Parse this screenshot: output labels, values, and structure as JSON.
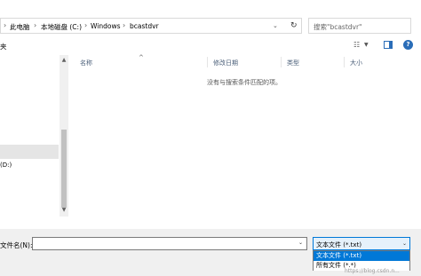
{
  "address_bar": {
    "breadcrumbs": [
      "此电脑",
      "本地磁盘 (C:)",
      "Windows",
      "bcastdvr"
    ],
    "search_placeholder": "搜索\"bcastdvr\""
  },
  "toolbar": {
    "left_label": "夹",
    "icons": [
      "view-options-icon",
      "preview-pane-icon",
      "help-icon"
    ],
    "help_glyph": "?"
  },
  "nav_pane": {
    "drive_label": "(D:)"
  },
  "file_list": {
    "columns": [
      "名称",
      "修改日期",
      "类型",
      "大小"
    ],
    "empty_message": "没有与搜索条件匹配的项。"
  },
  "bottom_bar": {
    "filename_label": "文件名(N):",
    "filename_value": "",
    "file_type_selected": "文本文件 (*.txt)",
    "file_type_options": [
      "文本文件 (*.txt)",
      "所有文件 (*.*)"
    ]
  },
  "watermark": "https://blog.csdn.n..."
}
